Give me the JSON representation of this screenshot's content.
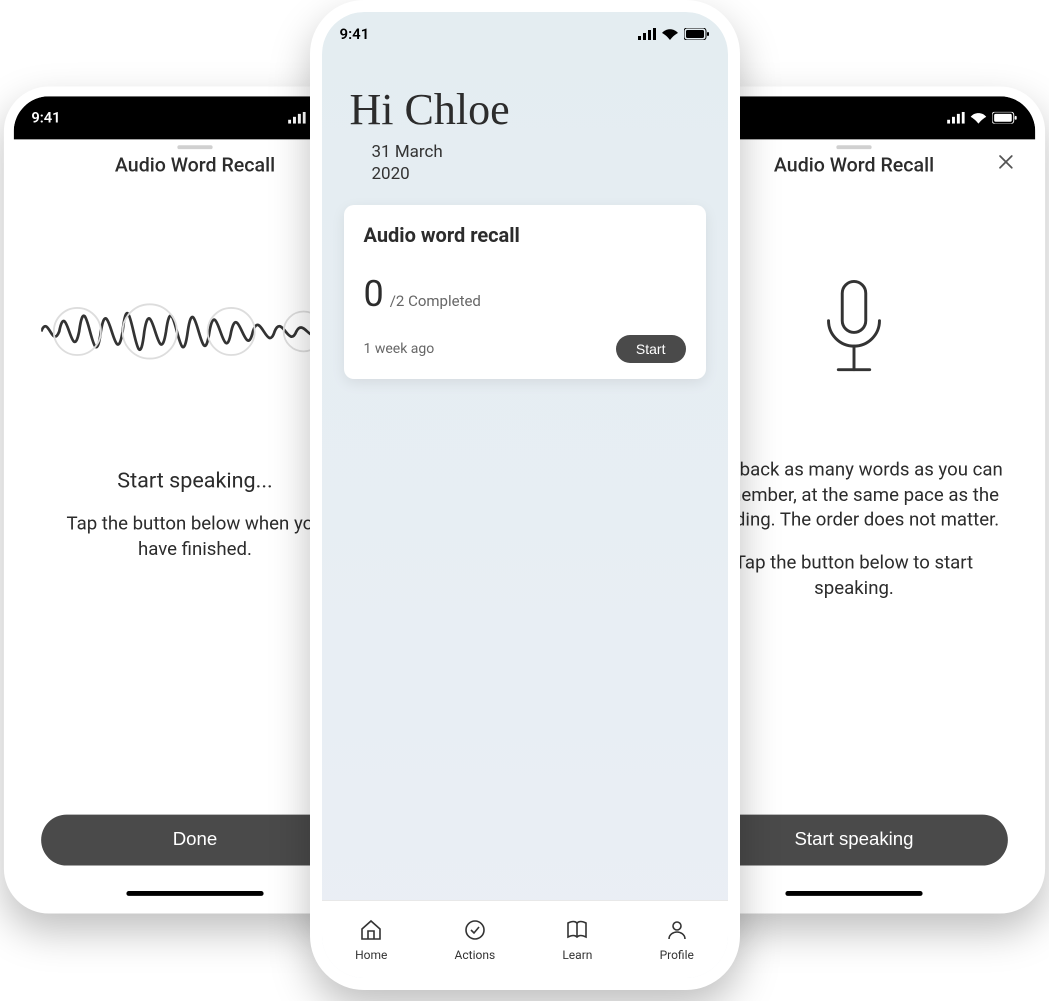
{
  "status": {
    "time": "9:41"
  },
  "left": {
    "title": "Audio Word Recall",
    "lead": "Start speaking...",
    "body": "Tap the button below when you have finished.",
    "cta": "Done"
  },
  "right": {
    "title": "Audio Word Recall",
    "body1": "Say back as many words as you can remember, at the same pace as the reading. The order does not matter.",
    "body2": "Tap the button below to start speaking.",
    "cta": "Start speaking"
  },
  "home": {
    "greeting": "Hi Chloe",
    "date_line1": "31 March",
    "date_line2": "2020",
    "card": {
      "title": "Audio word recall",
      "progress_done": "0",
      "progress_total": "/2 Completed",
      "time": "1 week ago",
      "cta": "Start"
    },
    "tabs": {
      "home": "Home",
      "actions": "Actions",
      "learn": "Learn",
      "profile": "Profile"
    }
  }
}
